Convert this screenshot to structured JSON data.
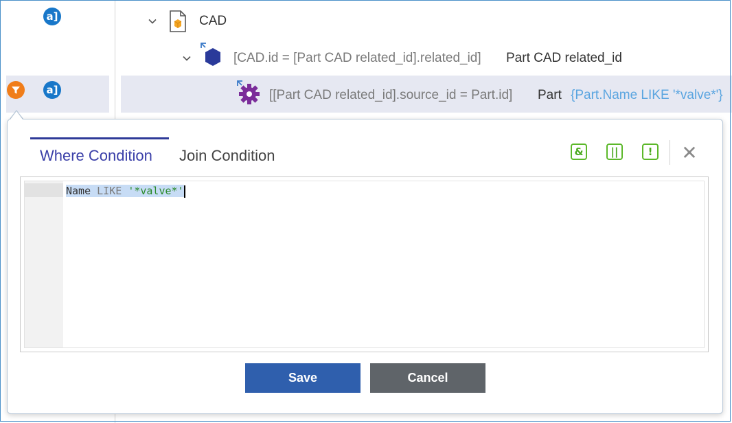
{
  "tree": {
    "cad_label": "CAD",
    "relation_row": {
      "condition": "[CAD.id = [Part CAD related_id].related_id]",
      "name": "Part CAD related_id"
    },
    "part_row": {
      "condition": "[[Part CAD related_id].source_id = Part.id]",
      "name": "Part",
      "filter": "{Part.Name LIKE '*valve*'}"
    }
  },
  "popover": {
    "tabs": {
      "where": "Where Condition",
      "join": "Join Condition"
    },
    "toolbar": {
      "and_symbol": "&",
      "or_symbol": "||",
      "not_symbol": "!",
      "close_symbol": "✕"
    },
    "editor": {
      "token_name": "Name",
      "token_like": "LIKE",
      "token_value": "'*valve*'"
    },
    "buttons": {
      "save": "Save",
      "cancel": "Cancel"
    }
  },
  "colors": {
    "accent": "#2f5fad",
    "tab_active": "#3a3fa8",
    "operator_green": "#5cb82a",
    "filter_orange": "#f07d1a",
    "aml_blue": "#1877c9",
    "polyitem_purple": "#7b2d9a",
    "relationship_navy": "#2a3a9a"
  },
  "icons": {
    "aml": "aml-icon",
    "filter": "filter-icon",
    "item": "cad-item-icon",
    "relationship": "relationship-icon",
    "settings": "gear-icon"
  }
}
